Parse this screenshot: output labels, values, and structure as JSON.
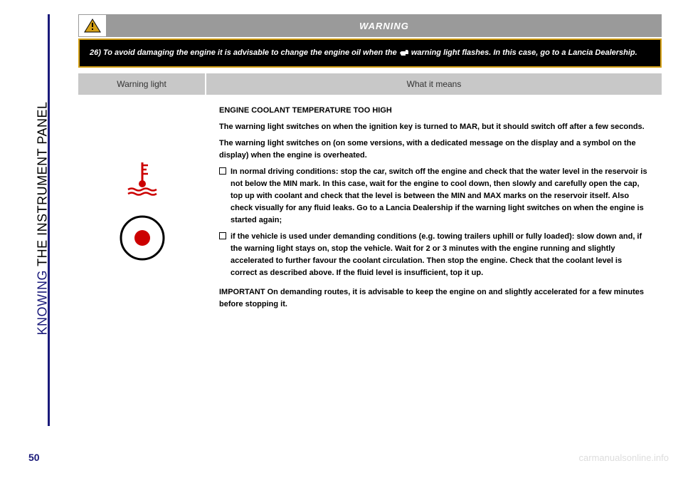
{
  "sidebar": {
    "prefix": "KNOWING",
    "rest": " THE INSTRUMENT PANEL"
  },
  "warning": {
    "title": "WARNING",
    "box_text_1": "26) To avoid damaging the engine it is advisable to change the engine oil when the ",
    "box_text_2": " warning light flashes. In this case, go to a Lancia Dealership."
  },
  "table": {
    "header_left": "Warning light",
    "header_right": "What it means",
    "body": {
      "title": "ENGINE COOLANT TEMPERATURE TOO HIGH",
      "p1": "The warning light switches on when the ignition key is turned to MAR, but it should switch off after a few seconds.",
      "p2": "The warning light switches on (on some versions, with a dedicated message on the display and a symbol on the display) when the engine is overheated.",
      "b1": "In normal driving conditions: stop the car, switch off the engine and check that the water level in the reservoir is not below the MIN mark. In this case, wait for the engine to cool down, then slowly and carefully open the cap, top up with coolant and check that the level is between the MIN and MAX marks on the reservoir itself. Also check visually for any fluid leaks. Go to a Lancia Dealership if the warning light switches on when the engine is started again;",
      "b2": "if the vehicle is used under demanding conditions (e.g. towing trailers uphill or fully loaded): slow down and, if the warning light stays on, stop the vehicle. Wait for 2 or 3 minutes with the engine running and slightly accelerated to further favour the coolant circulation. Then stop the engine. Check that the coolant level is correct as described above. If the fluid level is insufficient, top it up.",
      "important": "IMPORTANT On demanding routes, it is advisable to keep the engine on and slightly accelerated for a few minutes before stopping it."
    }
  },
  "page_number": "50",
  "watermark": "carmanualsonline.info"
}
